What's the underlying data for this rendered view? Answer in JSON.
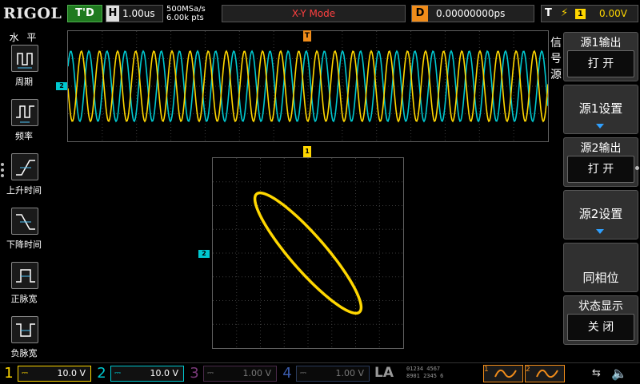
{
  "top": {
    "brand": "RIGOL",
    "trigger_status": "T'D",
    "horizontal_label": "H",
    "timebase": "1.00us",
    "sample_rate": "500MSa/s",
    "memory_depth": "6.00k pts",
    "mode": "X-Y Mode",
    "delay_label": "D",
    "delay": "0.00000000ps",
    "trigger_label": "T",
    "trigger_source": "1",
    "trigger_level": "0.00V"
  },
  "left_panel": {
    "title": "水 平",
    "items": [
      {
        "label": "周期",
        "icon": "period-icon"
      },
      {
        "label": "频率",
        "icon": "frequency-icon"
      },
      {
        "label": "上升时间",
        "icon": "rise-time-icon"
      },
      {
        "label": "下降时间",
        "icon": "fall-time-icon"
      },
      {
        "label": "正脉宽",
        "icon": "positive-width-icon"
      },
      {
        "label": "负脉宽",
        "icon": "negative-width-icon"
      }
    ]
  },
  "markers": {
    "trigger": "T",
    "ch2_yt": "2",
    "ch1_xy": "1",
    "ch2_xy": "2"
  },
  "right_menu": {
    "title": "信号源",
    "source1_output_label": "源1输出",
    "source1_output_value": "打 开",
    "source1_settings": "源1设置",
    "source2_output_label": "源2输出",
    "source2_output_value": "打 开",
    "source2_settings": "源2设置",
    "in_phase": "同相位",
    "status_display_label": "状态显示",
    "status_display_value": "关 闭"
  },
  "bottom": {
    "channels": [
      {
        "num": "1",
        "coupling": "⎓",
        "scale": "10.0 V",
        "color": "#ffd700",
        "active": true
      },
      {
        "num": "2",
        "coupling": "⎓",
        "scale": "10.0 V",
        "color": "#00c8d0",
        "active": true
      },
      {
        "num": "3",
        "coupling": "⎓",
        "scale": "1.00 V",
        "color": "#7a3a7a",
        "active": false
      },
      {
        "num": "4",
        "coupling": "⎓",
        "scale": "1.00 V",
        "color": "#2a4a8a",
        "active": false
      }
    ],
    "la": "LA",
    "la_grid_top": "01234  4567",
    "la_grid_bottom": "8901 2345 6",
    "ref1": "1",
    "ref2": "2"
  },
  "colors": {
    "ch1": "#ffd700",
    "ch2": "#00c8d0",
    "accent": "#f08c1a",
    "menu_arrow": "#2fa0ff"
  },
  "icons": {
    "usb": "usb-icon",
    "speaker": "speaker-muted-icon"
  }
}
